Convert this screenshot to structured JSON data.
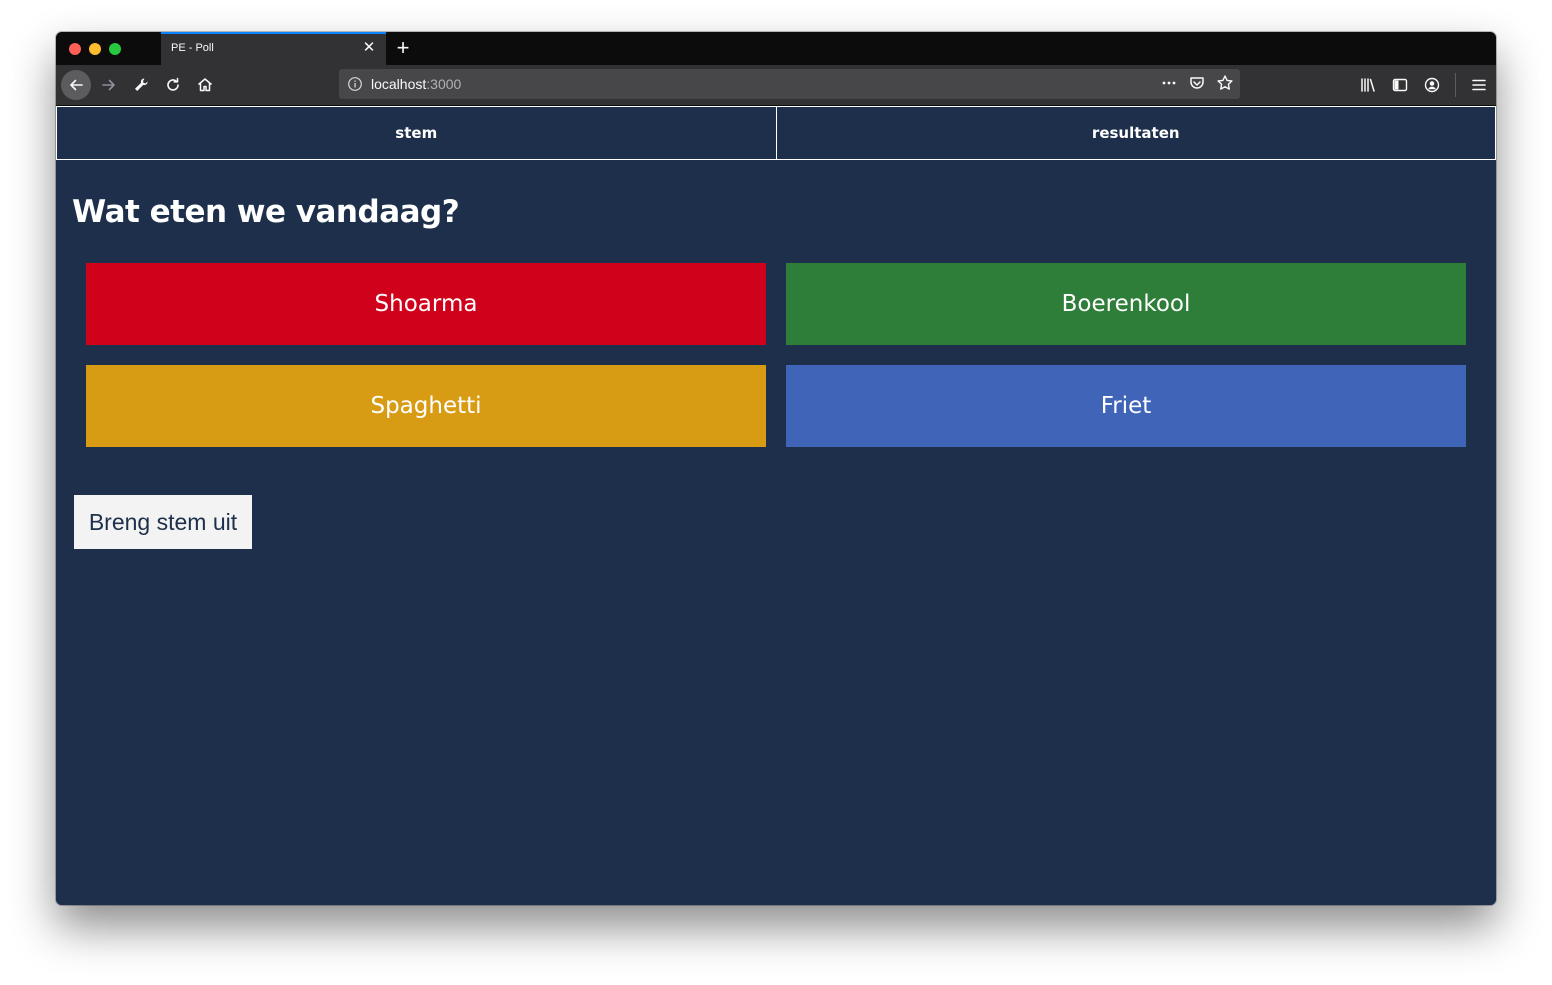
{
  "browser": {
    "tab_title": "PE - Poll",
    "url_host": "localhost",
    "url_port": ":3000"
  },
  "nav": {
    "tabs": [
      {
        "label": "stem"
      },
      {
        "label": "resultaten"
      }
    ]
  },
  "poll": {
    "question": "Wat eten we vandaag?",
    "options": [
      {
        "label": "Shoarma",
        "color": "#d0021b"
      },
      {
        "label": "Boerenkool",
        "color": "#2e7d39"
      },
      {
        "label": "Spaghetti",
        "color": "#d89b14"
      },
      {
        "label": "Friet",
        "color": "#4064b8"
      }
    ],
    "submit_label": "Breng stem uit"
  },
  "colors": {
    "background": "#1d2f4a"
  }
}
